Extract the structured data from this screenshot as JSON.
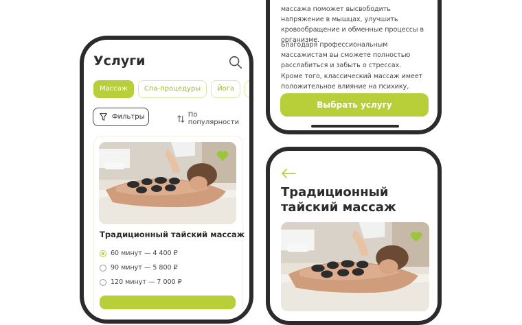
{
  "list_screen": {
    "title": "Услуги",
    "categories": [
      "Массаж",
      "Спа-процедуры",
      "Йога",
      "Масса"
    ],
    "filters_label": "Фильтры",
    "sort_label": "По популярности",
    "card": {
      "title": "Традиционный тайский массаж",
      "options": [
        {
          "label": "60 минут — 4 400 ₽",
          "selected": true
        },
        {
          "label": "90 минут — 5 800 ₽",
          "selected": false
        },
        {
          "label": "120 минут — 7 000 ₽",
          "selected": false
        }
      ]
    }
  },
  "description_screen": {
    "paragraphs": [
      "массажа поможет высвободить напряжение в мышцах, улучшить кровообращение и обменные процессы в организме.",
      "Благодаря профессиональным массажистам вы сможете полностью расслабиться и забыть о стрессах.",
      "Кроме того, классический массаж имеет положительное влияние на психику, улучшая"
    ],
    "choose_button": "Выбрать услугу"
  },
  "detail_screen": {
    "title": "Традиционный тайский массаж"
  },
  "colors": {
    "accent": "#b8cf3a",
    "accent_light": "#dbe9a7",
    "frame": "#2b2b2b",
    "text": "#2b2b2b"
  },
  "icons": [
    "search-icon",
    "filter-icon",
    "sort-icon",
    "heart-icon",
    "back-arrow-icon"
  ]
}
